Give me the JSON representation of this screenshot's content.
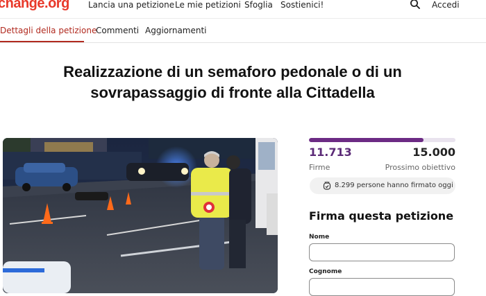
{
  "header": {
    "logo": "change.org",
    "nav": [
      "Lancia una petizione",
      "Le mie petizioni",
      "Sfoglia",
      "Sostienici!"
    ],
    "login": "Accedi",
    "search_icon": "search-icon"
  },
  "tabs": [
    "Dettagli della petizione",
    "Commenti",
    "Aggiornamenti"
  ],
  "petition": {
    "title_line1": "Realizzazione di un semaforo pedonale o di un",
    "title_line2": "sovrapassaggio di fronte alla Cittadella"
  },
  "signatures": {
    "count": "11.713",
    "count_label": "Firme",
    "goal": "15.000",
    "goal_label": "Prossimo obiettivo",
    "progress_fraction": 0.78,
    "today_text": "8.299 persone hanno firmato oggi",
    "today_icon": "signing-hand-icon"
  },
  "form": {
    "heading": "Firma questa petizione",
    "first_name_label": "Nome",
    "last_name_label": "Cognome"
  },
  "colors": {
    "brand": "#e8392a",
    "accent": "#6c2b84",
    "active_tab": "#b12a1f"
  }
}
